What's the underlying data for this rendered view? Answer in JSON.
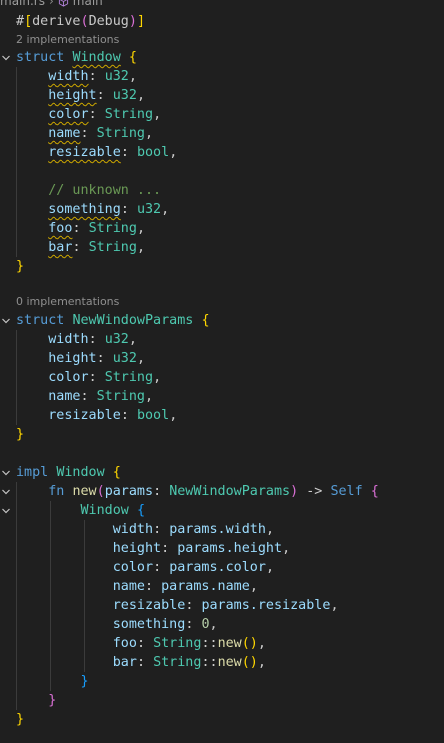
{
  "breadcrumb": {
    "file": "main.rs",
    "separator": "›",
    "symbol": "main"
  },
  "lenses": {
    "window": "2 implementations",
    "params": "0 implementations"
  },
  "code": {
    "derive": {
      "hash": "#",
      "open": "[",
      "name": "derive",
      "paren_open": "(",
      "arg": "Debug",
      "paren_close": ")",
      "close": "]"
    },
    "struct_kw": "struct",
    "window_name": "Window",
    "params_name": "NewWindowParams",
    "open_brace": "{",
    "close_brace": "}",
    "colon": ":",
    "comma": ",",
    "window_fields": [
      {
        "name": "width",
        "type": "u32"
      },
      {
        "name": "height",
        "type": "u32"
      },
      {
        "name": "color",
        "type": "String"
      },
      {
        "name": "name",
        "type": "String"
      },
      {
        "name": "resizable",
        "type": "bool"
      }
    ],
    "comment": "// unknown ...",
    "extra_fields": [
      {
        "name": "something",
        "type": "u32"
      },
      {
        "name": "foo",
        "type": "String"
      },
      {
        "name": "bar",
        "type": "String"
      }
    ],
    "params_fields": [
      {
        "name": "width",
        "type": "u32"
      },
      {
        "name": "height",
        "type": "u32"
      },
      {
        "name": "color",
        "type": "String"
      },
      {
        "name": "name",
        "type": "String"
      },
      {
        "name": "resizable",
        "type": "bool"
      }
    ],
    "impl_kw": "impl",
    "fn_kw": "fn",
    "fn_name": "new",
    "fn_param": "params",
    "arrow": "->",
    "self_type": "Self",
    "init": [
      {
        "name": "width",
        "value": "params.width"
      },
      {
        "name": "height",
        "value": "params.height"
      },
      {
        "name": "color",
        "value": "params.color"
      },
      {
        "name": "name",
        "value": "params.name"
      },
      {
        "name": "resizable",
        "value": "params.resizable"
      }
    ],
    "something_value": "0",
    "string_type": "String",
    "path_sep": "::",
    "call_parens": "()"
  },
  "colors": {
    "background": "#1f1f1f",
    "keyword": "#569cd6",
    "type": "#4ec9b0",
    "field": "#9cdcfe",
    "function": "#dcdcaa",
    "number": "#b5cea8",
    "comment": "#6a9955",
    "bracket_level_1": "#ffd700",
    "bracket_level_2": "#da70d6",
    "bracket_level_3": "#179fff",
    "warning_squiggle": "#cca700"
  },
  "icons": {
    "breadcrumb_symbol": "cube-icon",
    "folding": "chevron-down-icon"
  }
}
